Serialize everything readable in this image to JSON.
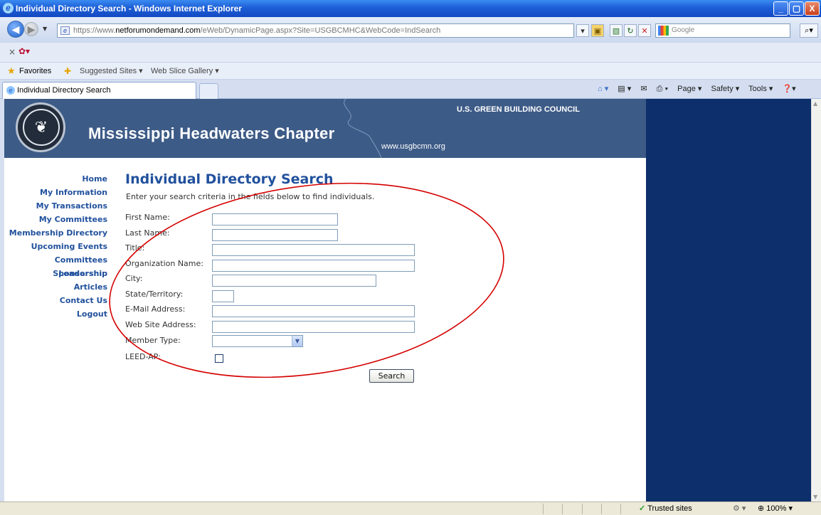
{
  "window": {
    "title": "Individual Directory Search - Windows Internet Explorer",
    "min_label": "_",
    "max_label": "▢",
    "close_label": "X"
  },
  "address_bar": {
    "url_prefix": "https://www.",
    "url_domain": "netforumondemand.com",
    "url_rest": "/eWeb/DynamicPage.aspx?Site=USGBCMHC&WebCode=IndSearch",
    "search_placeholder": "Google"
  },
  "favorites_bar": {
    "label": "Favorites",
    "links": [
      "Suggested Sites ▾",
      "Web Slice Gallery ▾"
    ]
  },
  "tabs": [
    {
      "label": "Individual Directory Search"
    }
  ],
  "command_bar": {
    "page": "Page ▾",
    "safety": "Safety ▾",
    "tools": "Tools ▾"
  },
  "banner": {
    "chapter_title": "Mississippi Headwaters Chapter",
    "org": "U.S. GREEN BUILDING COUNCIL",
    "url": "www.usgbcmn.org",
    "logo_glyph": "❦"
  },
  "nav": [
    "Home",
    "My Information",
    "My Transactions",
    "My Committees",
    "Membership Directory",
    "Upcoming Events",
    "Committees Leadership",
    "Sponsorship",
    "Articles",
    "Contact Us",
    "Logout"
  ],
  "main": {
    "heading": "Individual Directory Search",
    "instructions": "Enter your search criteria in the fields below to find individuals.",
    "fields": {
      "first_name": "First Name:",
      "last_name": "Last Name:",
      "title": "Title:",
      "organization": "Organization Name:",
      "city": "City:",
      "state": "State/Territory:",
      "email": "E-Mail Address:",
      "website": "Web Site Address:",
      "member_type": "Member Type:",
      "leed_ap": "LEED-AP:"
    },
    "search_button": "Search"
  },
  "status_bar": {
    "zone": "Trusted sites",
    "zoom": "100%  ▾"
  },
  "colors": {
    "banner": "#3d5b87",
    "right_panel": "#0d2f6b",
    "heading": "#21519d",
    "annotation": "#d40000"
  }
}
